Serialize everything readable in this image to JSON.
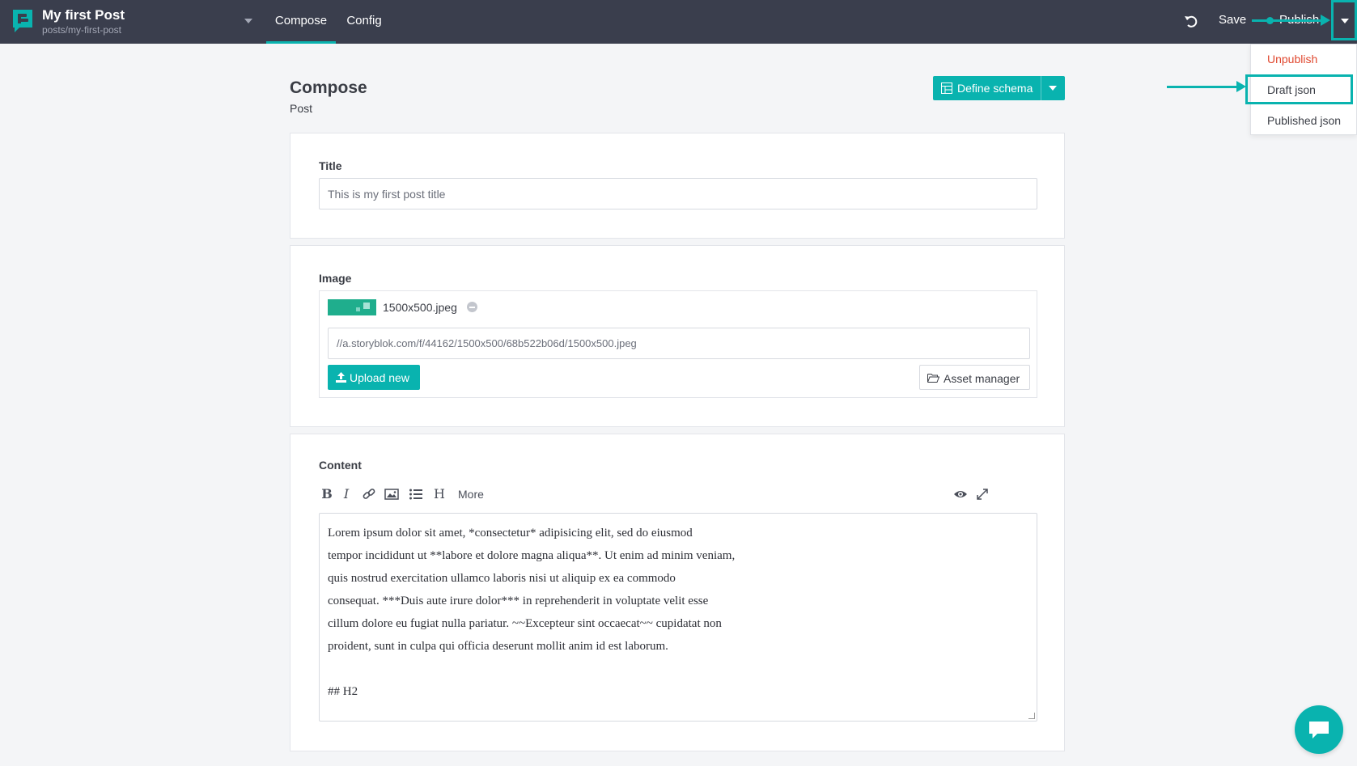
{
  "header": {
    "story_title": "My first Post",
    "story_slug": "posts/my-first-post",
    "tabs": [
      {
        "label": "Compose",
        "active": true
      },
      {
        "label": "Config",
        "active": false
      }
    ],
    "save_label": "Save",
    "publish_label": "Publish"
  },
  "publish_menu": {
    "items": [
      {
        "label": "Unpublish",
        "color": "#e0482f"
      },
      {
        "label": "Draft json",
        "highlighted": true
      },
      {
        "label": "Published json"
      }
    ]
  },
  "compose": {
    "title": "Compose",
    "subtitle": "Post",
    "define_schema_label": "Define schema"
  },
  "fields": {
    "title": {
      "label": "Title",
      "value": "This is my first post title"
    },
    "image": {
      "label": "Image",
      "filename": "1500x500.jpeg",
      "url": "//a.storyblok.com/f/44162/1500x500/68b522b06d/1500x500.jpeg",
      "upload_label": "Upload new",
      "asset_manager_label": "Asset manager"
    },
    "content": {
      "label": "Content",
      "toolbar": {
        "bold": "B",
        "italic": "I",
        "heading": "H",
        "more": "More"
      },
      "lines": [
        "Lorem ipsum dolor sit amet, *consectetur* adipisicing elit, sed do eiusmod",
        "tempor incididunt ut **labore et dolore magna aliqua**. Ut enim ad minim veniam,",
        "quis nostrud exercitation ullamco laboris nisi ut aliquip ex ea commodo",
        "consequat. ***Duis aute irure dolor*** in reprehenderit in voluptate velit esse",
        "cillum dolore eu fugiat nulla pariatur. ~~Excepteur sint occaecat~~ cupidatat non",
        "proident, sunt in culpa qui officia deserunt mollit anim id est laborum.",
        "",
        "## H2"
      ]
    }
  },
  "colors": {
    "accent": "#09b3af",
    "topbar": "#3a3e4d",
    "danger": "#e0482f"
  },
  "icons": [
    "storyblok-logo-icon",
    "undo-icon",
    "table-icon",
    "upload-icon",
    "folder-open-icon",
    "link-icon",
    "image-icon",
    "list-icon",
    "eye-icon",
    "expand-icon",
    "chat-icon"
  ]
}
